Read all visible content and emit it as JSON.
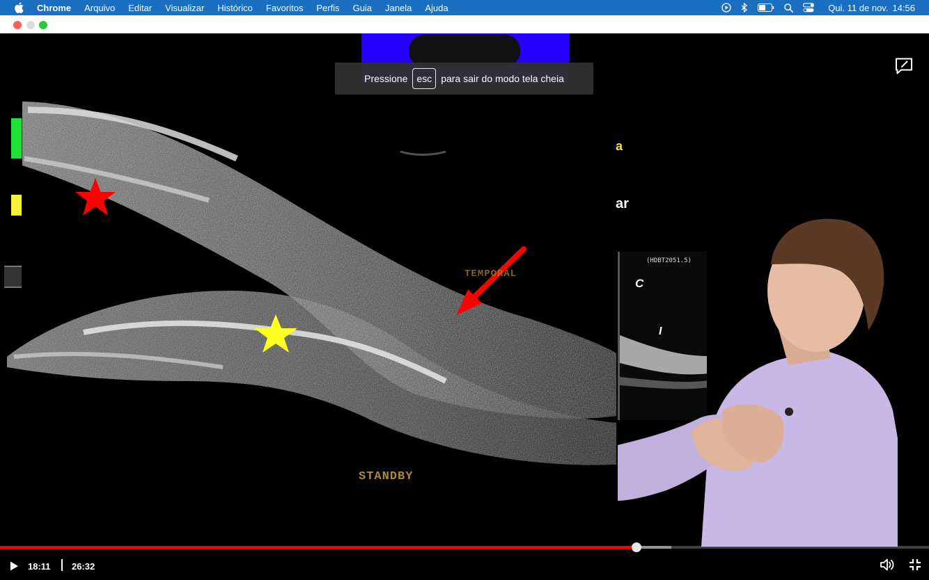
{
  "menubar": {
    "app": "Chrome",
    "items": [
      "Arquivo",
      "Editar",
      "Visualizar",
      "Histórico",
      "Favoritos",
      "Perfis",
      "Guia",
      "Janela",
      "Ajuda"
    ],
    "clock_day": "Qui. 11 de nov.",
    "clock_time": "14:56"
  },
  "toast": {
    "prefix": "Pressione",
    "key": "esc",
    "suffix": "para sair do modo tela cheia"
  },
  "slide": {
    "letter_a": "a",
    "letter_ar": "ar",
    "temporal": "TEMPORAL",
    "standby": "STANDBY",
    "inset_label": "(HDBT2051.5)",
    "inset_c": "C",
    "inset_i": "I"
  },
  "player": {
    "current_time": "18:11",
    "total_time": "26:32",
    "played_fraction": 0.6853,
    "buffered_fraction": 0.723
  },
  "colors": {
    "menubar": "#1a6fc0",
    "progress_played": "#ff0000",
    "logo_block": "#2600ff"
  }
}
